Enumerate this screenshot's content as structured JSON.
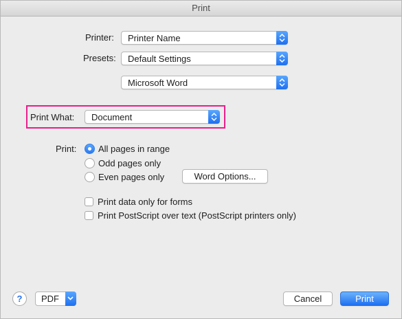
{
  "window": {
    "title": "Print"
  },
  "printer": {
    "label": "Printer:",
    "value": "Printer Name"
  },
  "presets": {
    "label": "Presets:",
    "value": "Default Settings"
  },
  "section": {
    "value": "Microsoft Word"
  },
  "print_what": {
    "label": "Print What:",
    "value": "Document"
  },
  "print": {
    "label": "Print:",
    "options": [
      {
        "label": "All pages in range",
        "selected": true
      },
      {
        "label": "Odd pages only",
        "selected": false
      },
      {
        "label": "Even pages only",
        "selected": false
      }
    ],
    "word_options_label": "Word Options..."
  },
  "checkboxes": [
    {
      "label": "Print data only for forms",
      "checked": false
    },
    {
      "label": "Print PostScript over text (PostScript printers only)",
      "checked": false
    }
  ],
  "footer": {
    "help": "?",
    "pdf_label": "PDF",
    "cancel_label": "Cancel",
    "print_label": "Print"
  },
  "colors": {
    "accent": "#1e6ff3",
    "highlight": "#e91e8c"
  },
  "icons": {
    "stepper": "up-down-chevron-icon",
    "pdf_menu": "chevron-down-icon",
    "help": "help-icon"
  }
}
